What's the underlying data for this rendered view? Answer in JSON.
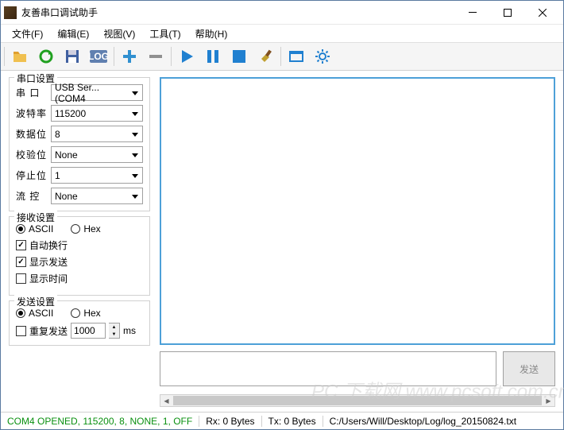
{
  "window": {
    "title": "友善串口调试助手"
  },
  "menu": {
    "file": "文件(F)",
    "edit": "编辑(E)",
    "view": "视图(V)",
    "tools": "工具(T)",
    "help": "帮助(H)"
  },
  "serial": {
    "group": "串口设置",
    "port_lbl": "串  口",
    "port_val": "USB Ser...(COM4",
    "baud_lbl": "波特率",
    "baud_val": "115200",
    "data_lbl": "数据位",
    "data_val": "8",
    "parity_lbl": "校验位",
    "parity_val": "None",
    "stop_lbl": "停止位",
    "stop_val": "1",
    "flow_lbl": "流  控",
    "flow_val": "None"
  },
  "recv": {
    "group": "接收设置",
    "ascii": "ASCII",
    "hex": "Hex",
    "wrap": "自动换行",
    "show_send": "显示发送",
    "show_time": "显示时间"
  },
  "send": {
    "group": "发送设置",
    "ascii": "ASCII",
    "hex": "Hex",
    "repeat": "重复发送",
    "interval": "1000",
    "unit": "ms",
    "btn": "发送"
  },
  "status": {
    "conn": "COM4 OPENED, 115200, 8, NONE, 1, OFF",
    "rx": "Rx: 0 Bytes",
    "tx": "Tx: 0 Bytes",
    "path": "C:/Users/Will/Desktop/Log/log_20150824.txt"
  },
  "watermark": "PC 下载网 www.pcsoft.com.cn"
}
